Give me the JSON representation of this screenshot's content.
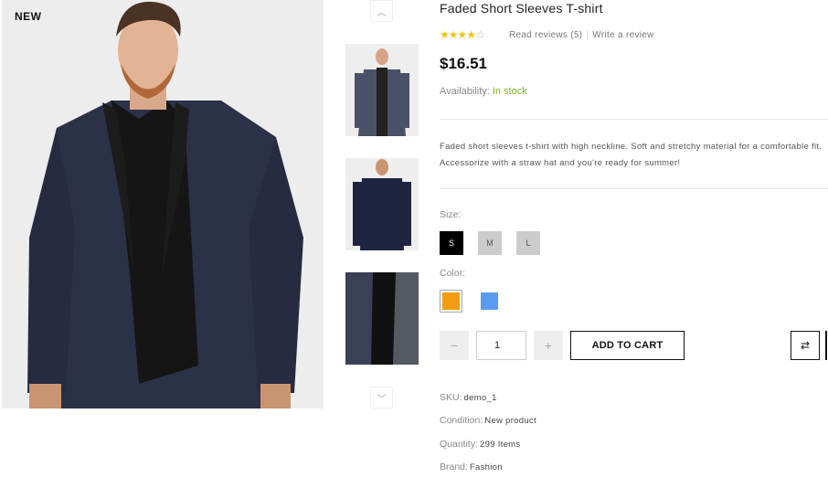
{
  "product": {
    "badge": "NEW",
    "title": "Faded Short Sleeves T-shirt",
    "rating": {
      "stars": 4,
      "max": 5
    },
    "reviews_link": "Read reviews (5)",
    "write_review": "Write a review",
    "price": "$16.51",
    "availability_label": "Availability:",
    "availability_value": "In stock",
    "description_line1": "Faded short sleeves t-shirt with high neckline. Soft and stretchy material for a comfortable fit.",
    "description_line2": "Accessorize with a straw hat and you're ready for summer!"
  },
  "options": {
    "size_label": "Size:",
    "sizes": [
      "S",
      "M",
      "L"
    ],
    "selected_size": "S",
    "color_label": "Color:",
    "colors": [
      "#f39c12",
      "#5b9bef"
    ],
    "selected_color": "#f39c12"
  },
  "cart": {
    "minus": "−",
    "plus": "+",
    "quantity": "1",
    "add_to_cart": "ADD TO CART",
    "compare_icon": "refresh-icon"
  },
  "meta": {
    "sku_label": "SKU:",
    "sku": "demo_1",
    "condition_label": "Condition:",
    "condition": "New product",
    "quantity_label": "Quantity:",
    "quantity": "299 Items",
    "brand_label": "Brand:",
    "brand": "Fashion"
  },
  "gallery": {
    "up_icon": "chevron-up-icon",
    "down_icon": "chevron-down-icon",
    "up_glyph": "︿",
    "down_glyph": "﹀"
  }
}
